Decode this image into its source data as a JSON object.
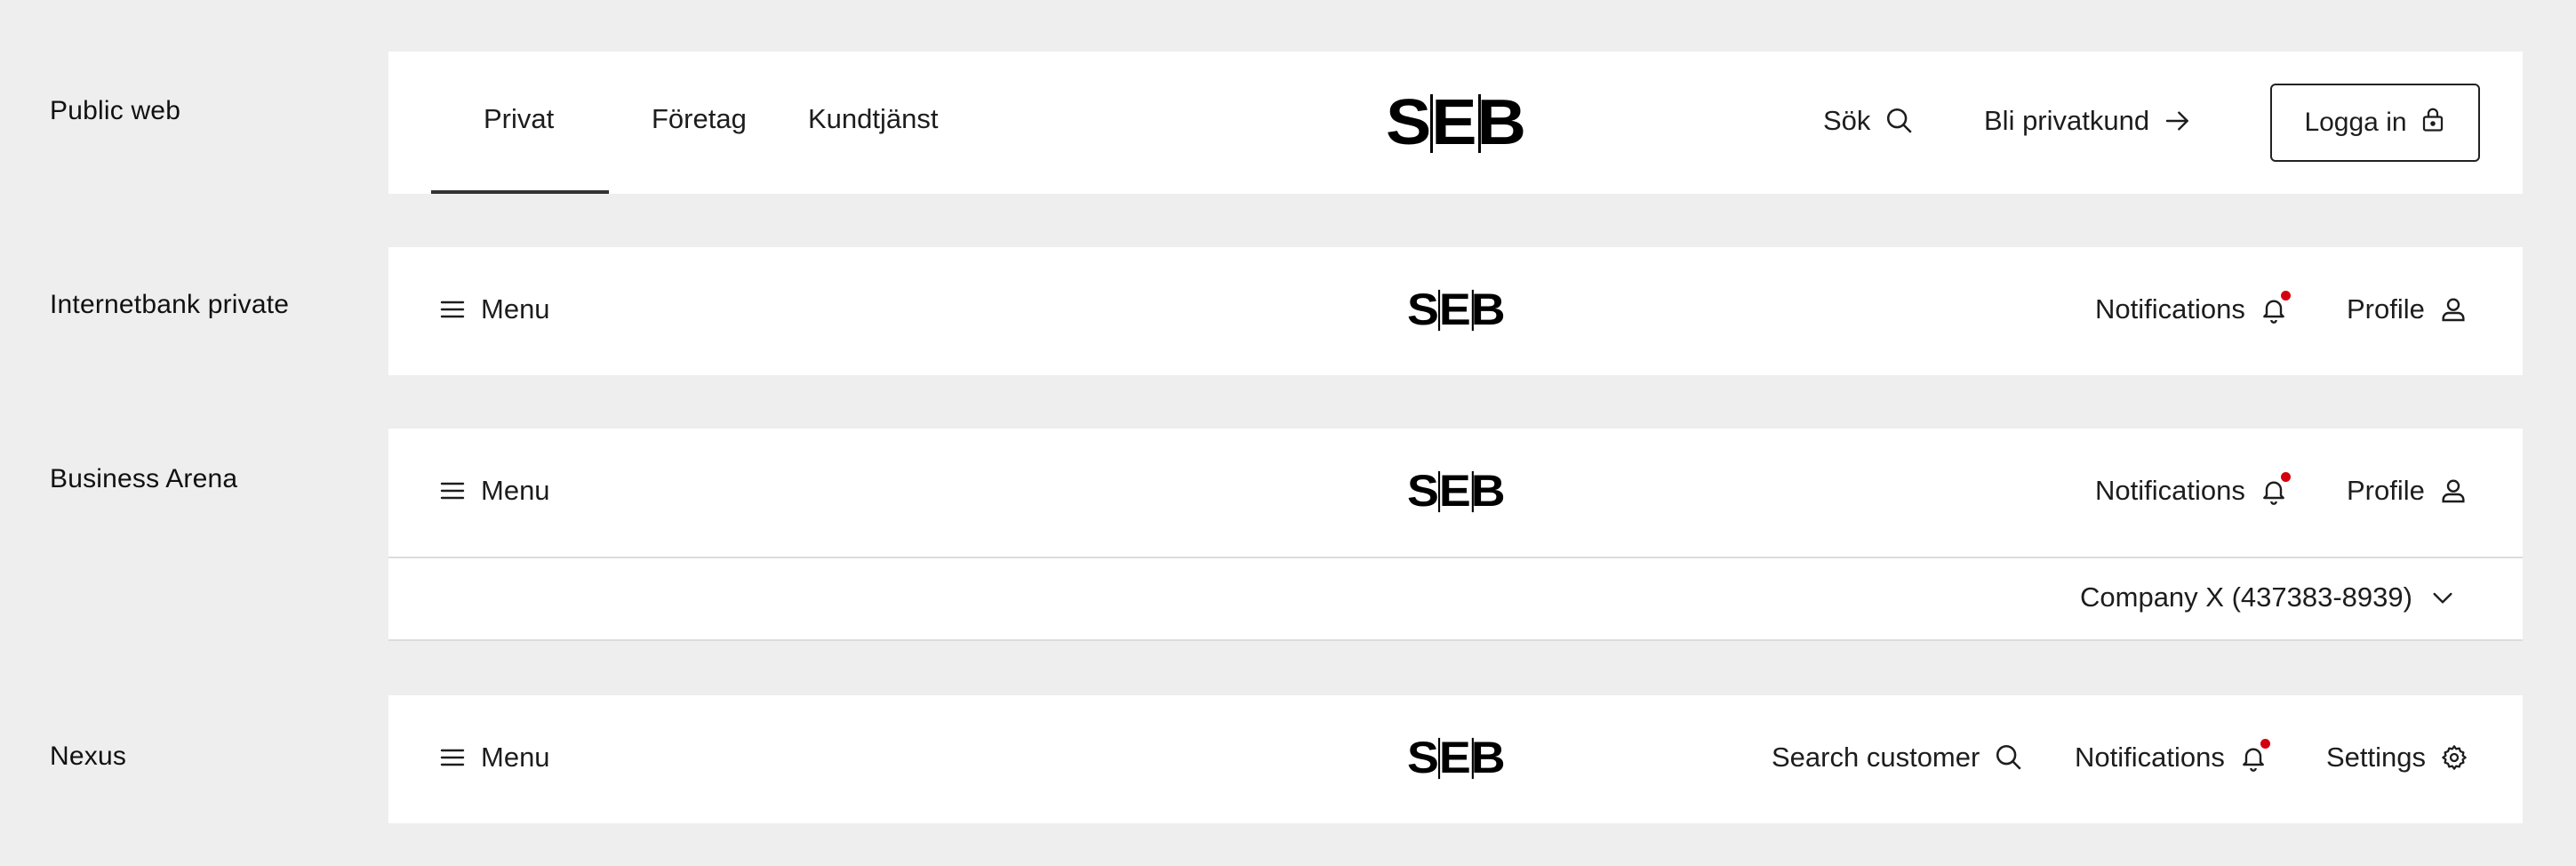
{
  "colors": {
    "page_bg": "#eeeeee",
    "bar_bg": "#ffffff",
    "text": "#1d1d1d",
    "notification_dot": "#d4000f",
    "divider": "#dcdcdc"
  },
  "logo_text": "SEB",
  "sections": {
    "public_web": {
      "label": "Public web",
      "tabs": [
        "Privat",
        "Företag",
        "Kundtjänst"
      ],
      "active_tab": "Privat",
      "search_label": "Sök",
      "become_customer_label": "Bli privatkund",
      "login_label": "Logga in"
    },
    "internetbank_private": {
      "label": "Internetbank private",
      "menu_label": "Menu",
      "notifications_label": "Notifications",
      "profile_label": "Profile"
    },
    "business_arena": {
      "label": "Business Arena",
      "menu_label": "Menu",
      "notifications_label": "Notifications",
      "profile_label": "Profile",
      "company_selector": "Company X (437383-8939)"
    },
    "nexus": {
      "label": "Nexus",
      "menu_label": "Menu",
      "search_customer_label": "Search customer",
      "notifications_label": "Notifications",
      "settings_label": "Settings"
    }
  },
  "icons": {
    "menu": "hamburger-icon",
    "search": "search-icon",
    "arrow": "arrow-right-icon",
    "lock": "lock-icon",
    "bell": "bell-icon",
    "profile": "user-icon",
    "chevron": "chevron-down-icon",
    "settings": "gear-icon"
  }
}
